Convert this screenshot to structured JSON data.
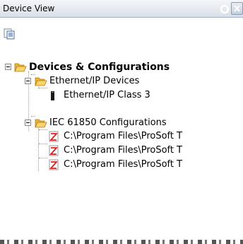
{
  "window": {
    "title": "Device View"
  },
  "toolbar": {
    "properties_icon": "properties-icon"
  },
  "tree": {
    "root": {
      "label": "Devices & Configurations",
      "icon": "folder-open-icon",
      "expanded": true
    },
    "ethernet_group": {
      "label": "Ethernet/IP Devices",
      "icon": "folder-open-icon",
      "expanded": true
    },
    "ethernet_device": {
      "label": "Ethernet/IP Class 3",
      "icon": "device-icon"
    },
    "iec_group": {
      "label": "IEC 61850 Configurations",
      "icon": "folder-open-icon",
      "expanded": true
    },
    "iec_items": [
      {
        "label": "C:\\Program Files\\ProSoft T",
        "icon": "config-file-error-icon"
      },
      {
        "label": "C:\\Program Files\\ProSoft T",
        "icon": "config-file-error-icon"
      },
      {
        "label": "C:\\Program Files\\ProSoft T",
        "icon": "config-file-error-icon"
      }
    ]
  },
  "colors": {
    "titlebar_top": "#f4f6f9",
    "titlebar_bottom": "#d9dfe8",
    "folder": "#f2c14e",
    "error_red": "#e02020"
  }
}
